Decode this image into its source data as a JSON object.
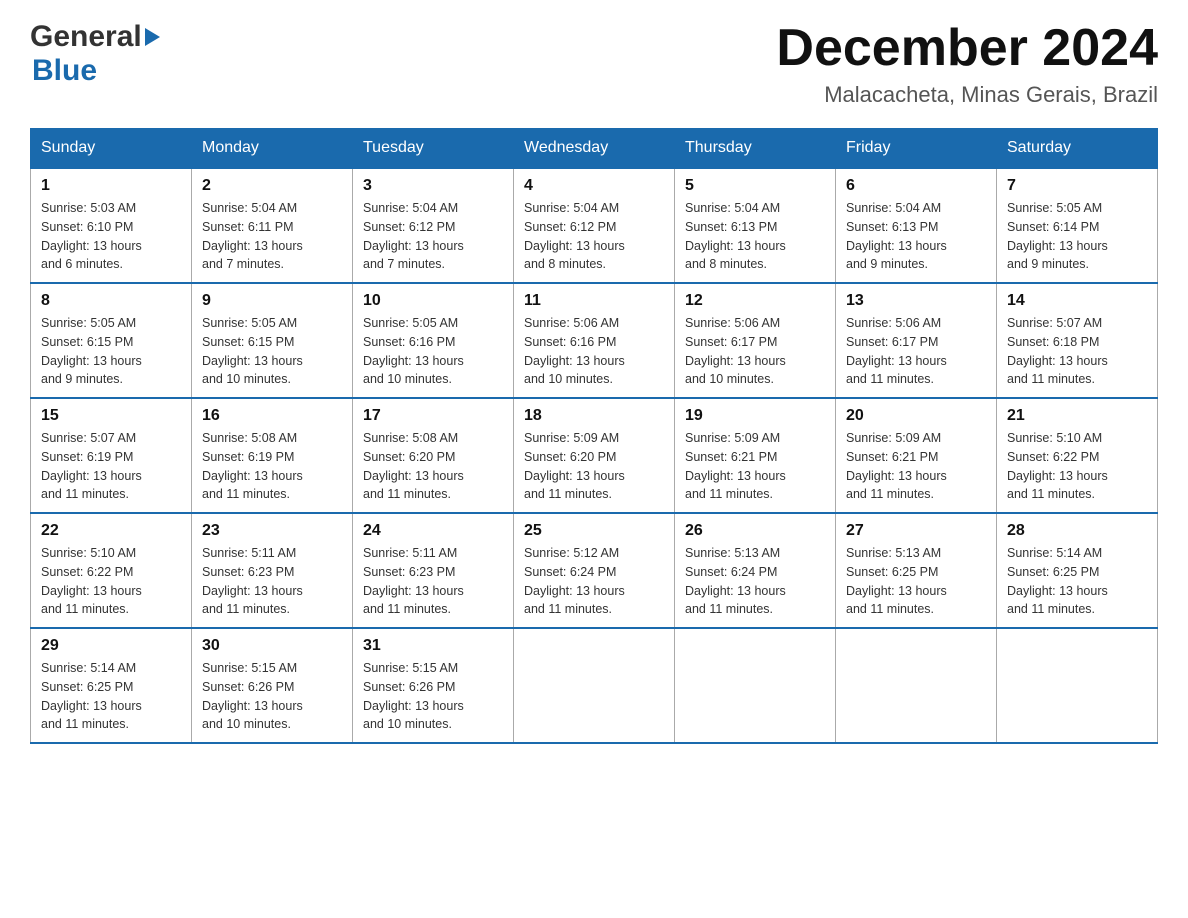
{
  "header": {
    "logo_general": "General",
    "logo_blue": "Blue",
    "month_title": "December 2024",
    "location": "Malacacheta, Minas Gerais, Brazil"
  },
  "days_of_week": [
    "Sunday",
    "Monday",
    "Tuesday",
    "Wednesday",
    "Thursday",
    "Friday",
    "Saturday"
  ],
  "weeks": [
    [
      {
        "day": "1",
        "sunrise": "5:03 AM",
        "sunset": "6:10 PM",
        "daylight": "13 hours and 6 minutes."
      },
      {
        "day": "2",
        "sunrise": "5:04 AM",
        "sunset": "6:11 PM",
        "daylight": "13 hours and 7 minutes."
      },
      {
        "day": "3",
        "sunrise": "5:04 AM",
        "sunset": "6:12 PM",
        "daylight": "13 hours and 7 minutes."
      },
      {
        "day": "4",
        "sunrise": "5:04 AM",
        "sunset": "6:12 PM",
        "daylight": "13 hours and 8 minutes."
      },
      {
        "day": "5",
        "sunrise": "5:04 AM",
        "sunset": "6:13 PM",
        "daylight": "13 hours and 8 minutes."
      },
      {
        "day": "6",
        "sunrise": "5:04 AM",
        "sunset": "6:13 PM",
        "daylight": "13 hours and 9 minutes."
      },
      {
        "day": "7",
        "sunrise": "5:05 AM",
        "sunset": "6:14 PM",
        "daylight": "13 hours and 9 minutes."
      }
    ],
    [
      {
        "day": "8",
        "sunrise": "5:05 AM",
        "sunset": "6:15 PM",
        "daylight": "13 hours and 9 minutes."
      },
      {
        "day": "9",
        "sunrise": "5:05 AM",
        "sunset": "6:15 PM",
        "daylight": "13 hours and 10 minutes."
      },
      {
        "day": "10",
        "sunrise": "5:05 AM",
        "sunset": "6:16 PM",
        "daylight": "13 hours and 10 minutes."
      },
      {
        "day": "11",
        "sunrise": "5:06 AM",
        "sunset": "6:16 PM",
        "daylight": "13 hours and 10 minutes."
      },
      {
        "day": "12",
        "sunrise": "5:06 AM",
        "sunset": "6:17 PM",
        "daylight": "13 hours and 10 minutes."
      },
      {
        "day": "13",
        "sunrise": "5:06 AM",
        "sunset": "6:17 PM",
        "daylight": "13 hours and 11 minutes."
      },
      {
        "day": "14",
        "sunrise": "5:07 AM",
        "sunset": "6:18 PM",
        "daylight": "13 hours and 11 minutes."
      }
    ],
    [
      {
        "day": "15",
        "sunrise": "5:07 AM",
        "sunset": "6:19 PM",
        "daylight": "13 hours and 11 minutes."
      },
      {
        "day": "16",
        "sunrise": "5:08 AM",
        "sunset": "6:19 PM",
        "daylight": "13 hours and 11 minutes."
      },
      {
        "day": "17",
        "sunrise": "5:08 AM",
        "sunset": "6:20 PM",
        "daylight": "13 hours and 11 minutes."
      },
      {
        "day": "18",
        "sunrise": "5:09 AM",
        "sunset": "6:20 PM",
        "daylight": "13 hours and 11 minutes."
      },
      {
        "day": "19",
        "sunrise": "5:09 AM",
        "sunset": "6:21 PM",
        "daylight": "13 hours and 11 minutes."
      },
      {
        "day": "20",
        "sunrise": "5:09 AM",
        "sunset": "6:21 PM",
        "daylight": "13 hours and 11 minutes."
      },
      {
        "day": "21",
        "sunrise": "5:10 AM",
        "sunset": "6:22 PM",
        "daylight": "13 hours and 11 minutes."
      }
    ],
    [
      {
        "day": "22",
        "sunrise": "5:10 AM",
        "sunset": "6:22 PM",
        "daylight": "13 hours and 11 minutes."
      },
      {
        "day": "23",
        "sunrise": "5:11 AM",
        "sunset": "6:23 PM",
        "daylight": "13 hours and 11 minutes."
      },
      {
        "day": "24",
        "sunrise": "5:11 AM",
        "sunset": "6:23 PM",
        "daylight": "13 hours and 11 minutes."
      },
      {
        "day": "25",
        "sunrise": "5:12 AM",
        "sunset": "6:24 PM",
        "daylight": "13 hours and 11 minutes."
      },
      {
        "day": "26",
        "sunrise": "5:13 AM",
        "sunset": "6:24 PM",
        "daylight": "13 hours and 11 minutes."
      },
      {
        "day": "27",
        "sunrise": "5:13 AM",
        "sunset": "6:25 PM",
        "daylight": "13 hours and 11 minutes."
      },
      {
        "day": "28",
        "sunrise": "5:14 AM",
        "sunset": "6:25 PM",
        "daylight": "13 hours and 11 minutes."
      }
    ],
    [
      {
        "day": "29",
        "sunrise": "5:14 AM",
        "sunset": "6:25 PM",
        "daylight": "13 hours and 11 minutes."
      },
      {
        "day": "30",
        "sunrise": "5:15 AM",
        "sunset": "6:26 PM",
        "daylight": "13 hours and 10 minutes."
      },
      {
        "day": "31",
        "sunrise": "5:15 AM",
        "sunset": "6:26 PM",
        "daylight": "13 hours and 10 minutes."
      },
      null,
      null,
      null,
      null
    ]
  ],
  "labels": {
    "sunrise": "Sunrise:",
    "sunset": "Sunset:",
    "daylight": "Daylight:"
  }
}
